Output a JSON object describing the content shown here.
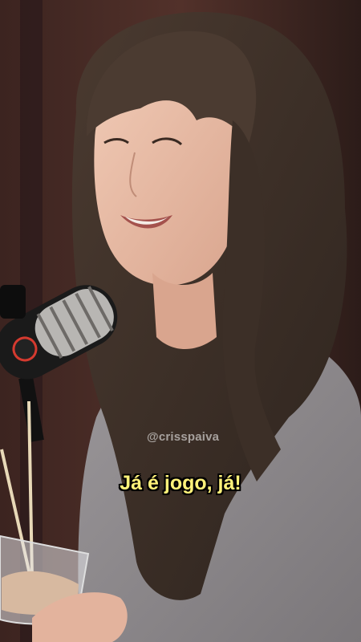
{
  "video": {
    "watermark": "@crisspaiva",
    "subtitle": "Já é jogo, já!"
  }
}
